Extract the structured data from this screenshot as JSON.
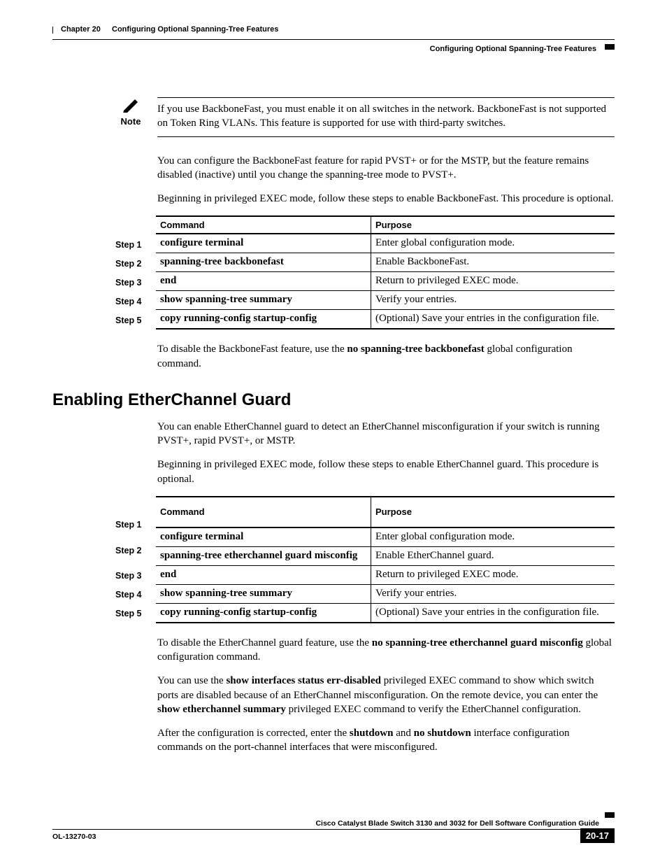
{
  "header": {
    "chapter_label": "Chapter 20",
    "chapter_title": "Configuring Optional Spanning-Tree Features",
    "section_title": "Configuring Optional Spanning-Tree Features"
  },
  "note": {
    "label": "Note",
    "text": "If you use BackboneFast, you must enable it on all switches in the network. BackboneFast is not supported on Token Ring VLANs. This feature is supported for use with third-party switches."
  },
  "intro1": {
    "p1": "You can configure the BackboneFast feature for rapid PVST+ or for the MSTP, but the feature remains disabled (inactive) until you change the spanning-tree mode to PVST+.",
    "p2": "Beginning in privileged EXEC mode, follow these steps to enable BackboneFast. This procedure is optional."
  },
  "table1": {
    "header_command": "Command",
    "header_purpose": "Purpose",
    "steps_label": [
      "Step 1",
      "Step 2",
      "Step 3",
      "Step 4",
      "Step 5"
    ],
    "rows": [
      {
        "cmd": "configure terminal",
        "purpose": "Enter global configuration mode."
      },
      {
        "cmd": "spanning-tree backbonefast",
        "purpose": "Enable BackboneFast."
      },
      {
        "cmd": "end",
        "purpose": "Return to privileged EXEC mode."
      },
      {
        "cmd": "show spanning-tree summary",
        "purpose": "Verify your entries."
      },
      {
        "cmd": "copy running-config startup-config",
        "purpose": "(Optional) Save your entries in the configuration file."
      }
    ]
  },
  "after_table1": {
    "pre": "To disable the BackboneFast feature, use the ",
    "bold": "no spanning-tree backbonefast",
    "post": " global configuration command."
  },
  "section2": {
    "heading": "Enabling EtherChannel Guard",
    "p1": "You can enable EtherChannel guard to detect an EtherChannel misconfiguration if your switch is running PVST+, rapid PVST+, or MSTP.",
    "p2": "Beginning in privileged EXEC mode, follow these steps to enable EtherChannel guard. This procedure is optional."
  },
  "table2": {
    "header_command": "Command",
    "header_purpose": "Purpose",
    "steps_label": [
      "Step 1",
      "Step 2",
      "Step 3",
      "Step 4",
      "Step 5"
    ],
    "rows": [
      {
        "cmd": "configure terminal",
        "purpose": "Enter global configuration mode."
      },
      {
        "cmd": "spanning-tree etherchannel guard misconfig",
        "purpose": "Enable EtherChannel guard."
      },
      {
        "cmd": "end",
        "purpose": "Return to privileged EXEC mode."
      },
      {
        "cmd": "show spanning-tree summary",
        "purpose": "Verify your entries."
      },
      {
        "cmd": "copy running-config startup-config",
        "purpose": "(Optional) Save your entries in the configuration file."
      }
    ]
  },
  "after_table2": {
    "p1_pre": "To disable the EtherChannel guard feature, use the ",
    "p1_bold": "no spanning-tree etherchannel guard misconfig",
    "p1_post": " global configuration command.",
    "p2_a": "You can use the ",
    "p2_b": "show interfaces status err-disabled",
    "p2_c": " privileged EXEC command to show which switch ports are disabled because of an EtherChannel misconfiguration. On the remote device, you can enter the ",
    "p2_d": "show etherchannel summary",
    "p2_e": " privileged EXEC command to verify the EtherChannel configuration.",
    "p3_a": "After the configuration is corrected, enter the ",
    "p3_b": "shutdown",
    "p3_c": " and ",
    "p3_d": "no shutdown",
    "p3_e": " interface configuration commands on the port-channel interfaces that were misconfigured."
  },
  "footer": {
    "guide_title": "Cisco Catalyst Blade Switch 3130 and 3032 for Dell Software Configuration Guide",
    "doc_id": "OL-13270-03",
    "page_num": "20-17"
  }
}
